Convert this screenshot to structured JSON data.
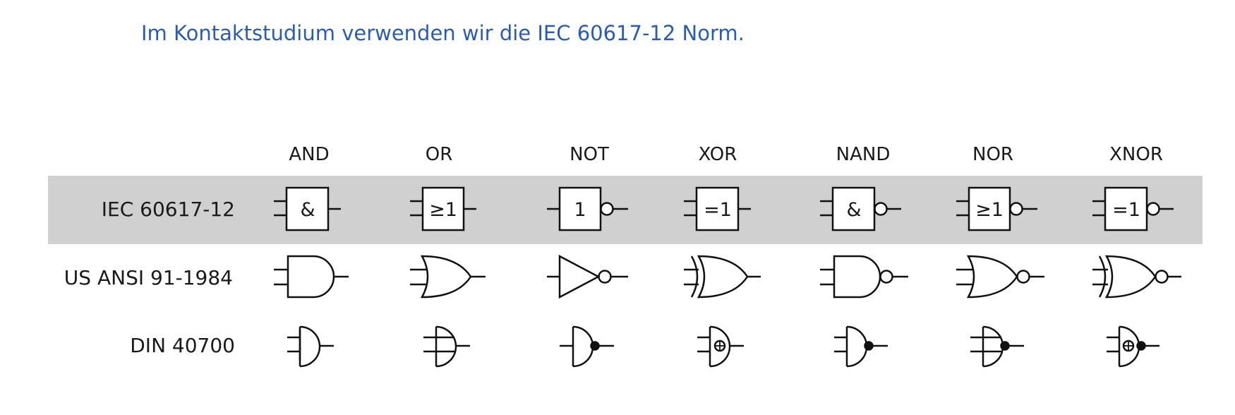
{
  "heading": "Im Kontaktstudium verwenden wir die IEC 60617-12 Norm.",
  "highlight_color": "#d0d0d0",
  "columns": [
    "AND",
    "OR",
    "NOT",
    "XOR",
    "NAND",
    "NOR",
    "XNOR"
  ],
  "rows": [
    {
      "label": "IEC 60617-12",
      "symbols": [
        {
          "gate": "AND",
          "text": "&"
        },
        {
          "gate": "OR",
          "text": "≥1"
        },
        {
          "gate": "NOT",
          "text": "1"
        },
        {
          "gate": "XOR",
          "text": "=1"
        },
        {
          "gate": "NAND",
          "text": "&"
        },
        {
          "gate": "NOR",
          "text": "≥1"
        },
        {
          "gate": "XNOR",
          "text": "=1"
        }
      ]
    },
    {
      "label": "US ANSI 91-1984"
    },
    {
      "label": "DIN 40700"
    }
  ]
}
